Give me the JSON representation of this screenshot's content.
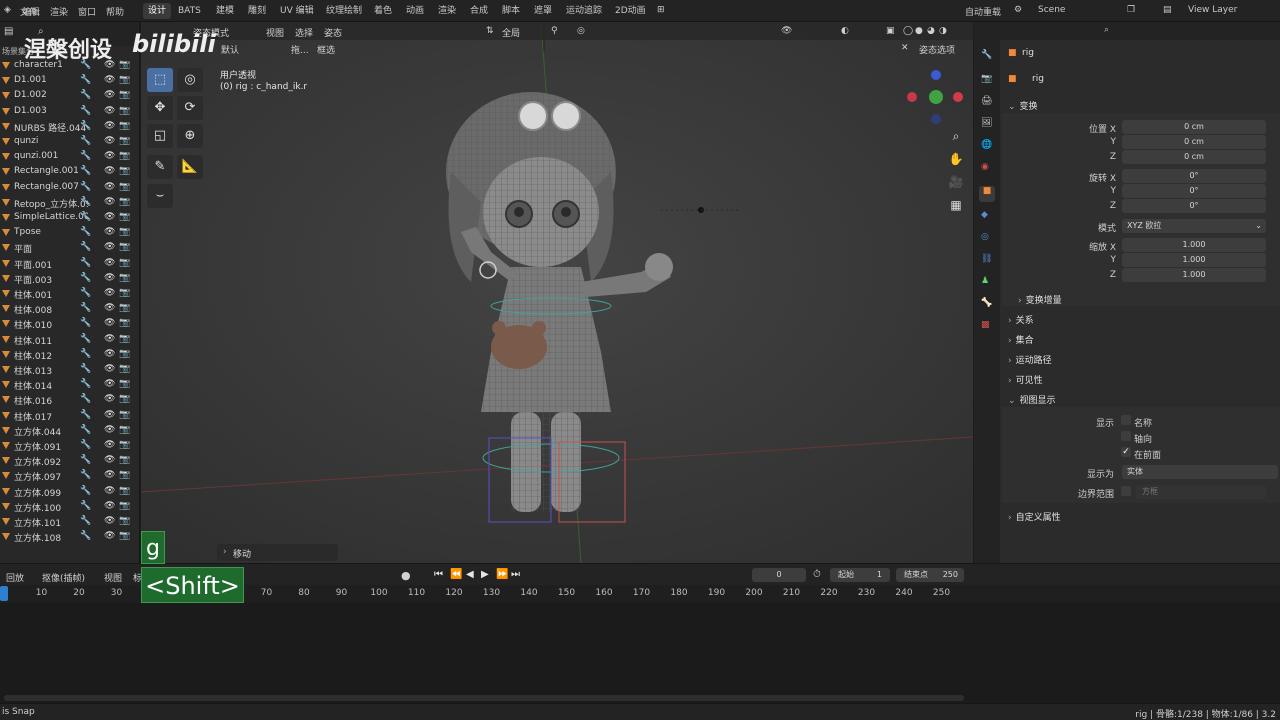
{
  "menu": {
    "items": [
      "文件",
      "编辑",
      "渲染",
      "窗口",
      "帮助"
    ],
    "workspaces": [
      "设计",
      "BATS",
      "建模",
      "雕刻",
      "UV 编辑",
      "纹理绘制",
      "着色",
      "动画",
      "渲染",
      "合成",
      "脚本",
      "遮罩",
      "运动追踪",
      "2D动画"
    ],
    "active_workspace": "设计",
    "right_label1": "自动重载",
    "scene": "Scene",
    "view_layer": "View Layer"
  },
  "watermark": {
    "text": "涅槃创设",
    "brand": "bilibili"
  },
  "outliner": {
    "header": "场景集合",
    "items": [
      {
        "name": "character1"
      },
      {
        "name": "D1.001"
      },
      {
        "name": "D1.002"
      },
      {
        "name": "D1.003"
      },
      {
        "name": "NURBS 路径.044"
      },
      {
        "name": "qunzi"
      },
      {
        "name": "qunzi.001"
      },
      {
        "name": "Rectangle.001"
      },
      {
        "name": "Rectangle.007"
      },
      {
        "name": "Retopo_立方体.09("
      },
      {
        "name": "SimpleLattice.001"
      },
      {
        "name": "Tpose"
      },
      {
        "name": "平面"
      },
      {
        "name": "平面.001"
      },
      {
        "name": "平面.003"
      },
      {
        "name": "柱体.001"
      },
      {
        "name": "柱体.008"
      },
      {
        "name": "柱体.010"
      },
      {
        "name": "柱体.011"
      },
      {
        "name": "柱体.012"
      },
      {
        "name": "柱体.013"
      },
      {
        "name": "柱体.014"
      },
      {
        "name": "柱体.016"
      },
      {
        "name": "柱体.017"
      },
      {
        "name": "立方体.044"
      },
      {
        "name": "立方体.091"
      },
      {
        "name": "立方体.092"
      },
      {
        "name": "立方体.097"
      },
      {
        "name": "立方体.099"
      },
      {
        "name": "立方体.100"
      },
      {
        "name": "立方体.101"
      },
      {
        "name": "立方体.108"
      }
    ]
  },
  "viewport": {
    "mode": "姿态模式",
    "orientation": "默认",
    "drag": "拖...",
    "select_mode": "框选",
    "menus": [
      "视图",
      "选择",
      "姿态"
    ],
    "transform_pivot": "全局",
    "overlay_label": "姿态选项",
    "view_name": "用户透视",
    "active_info": "(0) rig : c_hand_ik.r",
    "last_op": "移动"
  },
  "keys": {
    "key1": "g",
    "key2": "<Shift>"
  },
  "properties": {
    "object_name": "rig",
    "data_name": "rig",
    "transform_header": "变换",
    "location_label": "位置 X",
    "location": [
      "0 cm",
      "0 cm",
      "0 cm"
    ],
    "rotation_label": "旋转 X",
    "rotation": [
      "0°",
      "0°",
      "0°"
    ],
    "mode_label": "模式",
    "mode_value": "XYZ 欧拉",
    "scale_label": "缩放 X",
    "scale": [
      "1.000",
      "1.000",
      "1.000"
    ],
    "axis_y": "Y",
    "axis_z": "Z",
    "delta": "变换增量",
    "sections": [
      "关系",
      "集合",
      "运动路径",
      "可见性"
    ],
    "viewport_display": "视图显示",
    "show_label": "显示",
    "show_name": "名称",
    "show_axes": "轴向",
    "show_in_front": "在前面",
    "display_as_label": "显示为",
    "display_as": "实体",
    "bounds_label": "边界范围",
    "bounds_value": "方框",
    "custom_props": "自定义属性"
  },
  "timeline": {
    "menus": [
      "回放",
      "抠像(插帧)",
      "视图",
      "标记"
    ],
    "current_frame": "0",
    "start_label": "起始",
    "start": "1",
    "end_label": "结束点",
    "end": "250",
    "ticks": [
      "0",
      "10",
      "20",
      "30",
      "40",
      "50",
      "60",
      "70",
      "80",
      "90",
      "100",
      "110",
      "120",
      "130",
      "140",
      "150",
      "160",
      "170",
      "180",
      "190",
      "200",
      "210",
      "220",
      "230",
      "240",
      "250"
    ]
  },
  "status": {
    "left": "is Snap",
    "right": "rig | 骨骼:1/238 | 物体:1/86 | 3.2"
  }
}
